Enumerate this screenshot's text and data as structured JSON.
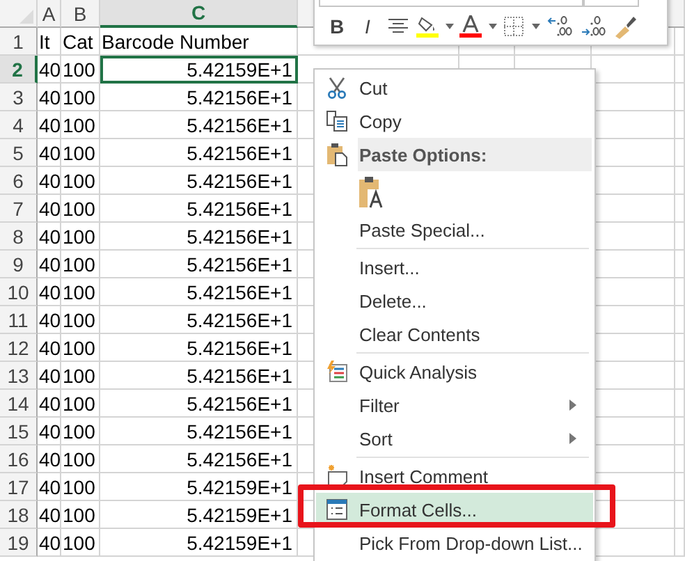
{
  "columns": [
    {
      "label": "A",
      "selected": false
    },
    {
      "label": "B",
      "selected": false
    },
    {
      "label": "C",
      "selected": true
    }
  ],
  "rows": [
    {
      "number": "1",
      "selected": false,
      "cells": [
        "It",
        "Cat",
        "Barcode Number"
      ]
    },
    {
      "number": "2",
      "selected": true,
      "cells": [
        "40",
        "100",
        "5.42159E+1"
      ]
    },
    {
      "number": "3",
      "selected": false,
      "cells": [
        "40",
        "100",
        "5.42156E+1"
      ]
    },
    {
      "number": "4",
      "selected": false,
      "cells": [
        "40",
        "100",
        "5.42156E+1"
      ]
    },
    {
      "number": "5",
      "selected": false,
      "cells": [
        "40",
        "100",
        "5.42156E+1"
      ]
    },
    {
      "number": "6",
      "selected": false,
      "cells": [
        "40",
        "100",
        "5.42156E+1"
      ]
    },
    {
      "number": "7",
      "selected": false,
      "cells": [
        "40",
        "100",
        "5.42156E+1"
      ]
    },
    {
      "number": "8",
      "selected": false,
      "cells": [
        "40",
        "100",
        "5.42156E+1"
      ]
    },
    {
      "number": "9",
      "selected": false,
      "cells": [
        "40",
        "100",
        "5.42156E+1"
      ]
    },
    {
      "number": "10",
      "selected": false,
      "cells": [
        "40",
        "100",
        "5.42156E+1"
      ]
    },
    {
      "number": "11",
      "selected": false,
      "cells": [
        "40",
        "100",
        "5.42156E+1"
      ]
    },
    {
      "number": "12",
      "selected": false,
      "cells": [
        "40",
        "100",
        "5.42156E+1"
      ]
    },
    {
      "number": "13",
      "selected": false,
      "cells": [
        "40",
        "100",
        "5.42156E+1"
      ]
    },
    {
      "number": "14",
      "selected": false,
      "cells": [
        "40",
        "100",
        "5.42156E+1"
      ]
    },
    {
      "number": "15",
      "selected": false,
      "cells": [
        "40",
        "100",
        "5.42156E+1"
      ]
    },
    {
      "number": "16",
      "selected": false,
      "cells": [
        "40",
        "100",
        "5.42156E+1"
      ]
    },
    {
      "number": "17",
      "selected": false,
      "cells": [
        "40",
        "100",
        "5.42159E+1"
      ]
    },
    {
      "number": "18",
      "selected": false,
      "cells": [
        "40",
        "100",
        "5.42159E+1"
      ]
    },
    {
      "number": "19",
      "selected": false,
      "cells": [
        "40",
        "100",
        "5.42159E+1"
      ]
    }
  ],
  "mini_toolbar": {
    "buttons": [
      {
        "kind": "bold",
        "label": "B"
      },
      {
        "kind": "italic",
        "label": "I"
      },
      {
        "kind": "align"
      },
      {
        "kind": "fill"
      },
      {
        "kind": "dropdown"
      },
      {
        "kind": "font-color"
      },
      {
        "kind": "dropdown"
      },
      {
        "kind": "borders"
      },
      {
        "kind": "dropdown"
      },
      {
        "kind": "increase-decimal"
      },
      {
        "kind": "decrease-decimal"
      },
      {
        "kind": "painter"
      }
    ]
  },
  "context_menu": {
    "items": [
      {
        "kind": "item",
        "label": "Cut",
        "submenu": false,
        "selected": false
      },
      {
        "kind": "item",
        "label": "Copy",
        "submenu": false,
        "selected": false
      },
      {
        "kind": "header",
        "label": "Paste Options:"
      },
      {
        "kind": "paste-options"
      },
      {
        "kind": "item",
        "label": "Paste Special...",
        "submenu": false,
        "selected": false
      },
      {
        "kind": "separator"
      },
      {
        "kind": "item",
        "label": "Insert...",
        "submenu": false,
        "selected": false
      },
      {
        "kind": "item",
        "label": "Delete...",
        "submenu": false,
        "selected": false
      },
      {
        "kind": "item",
        "label": "Clear Contents",
        "submenu": false,
        "selected": false
      },
      {
        "kind": "separator"
      },
      {
        "kind": "item",
        "label": "Quick Analysis",
        "submenu": false,
        "selected": false
      },
      {
        "kind": "item",
        "label": "Filter",
        "submenu": true,
        "selected": false
      },
      {
        "kind": "item",
        "label": "Sort",
        "submenu": true,
        "selected": false
      },
      {
        "kind": "separator"
      },
      {
        "kind": "item",
        "label": "Insert Comment",
        "submenu": false,
        "selected": false
      },
      {
        "kind": "item",
        "label": "Format Cells...",
        "submenu": false,
        "selected": true
      },
      {
        "kind": "item",
        "label": "Pick From Drop-down List...",
        "submenu": false,
        "selected": false
      }
    ]
  }
}
